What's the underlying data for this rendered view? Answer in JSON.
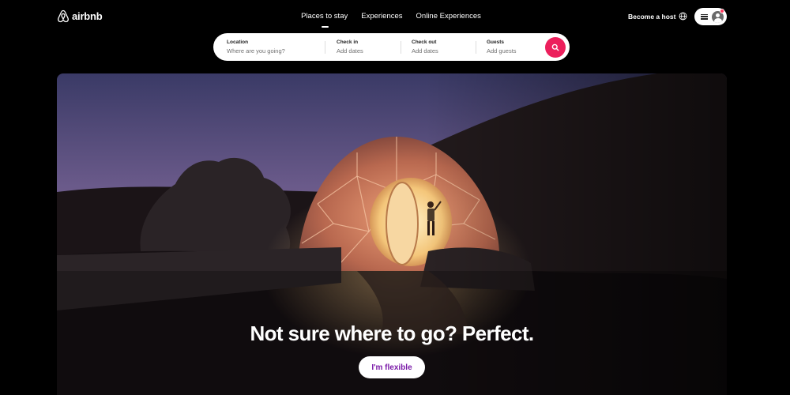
{
  "brand": {
    "name": "airbnb",
    "color": "#ff385c"
  },
  "nav": {
    "items": [
      {
        "label": "Places to stay",
        "active": true
      },
      {
        "label": "Experiences",
        "active": false
      },
      {
        "label": "Online Experiences",
        "active": false
      }
    ]
  },
  "header_right": {
    "become_host": "Become a host",
    "globe_icon": "globe-icon",
    "menu_icon": "hamburger-icon",
    "avatar_icon": "user-avatar-icon",
    "has_notification": true
  },
  "search": {
    "location": {
      "label": "Location",
      "placeholder": "Where are you going?"
    },
    "check_in": {
      "label": "Check in",
      "placeholder": "Add dates"
    },
    "check_out": {
      "label": "Check out",
      "placeholder": "Add dates"
    },
    "guests": {
      "label": "Guests",
      "placeholder": "Add guests"
    },
    "button_icon": "search-icon",
    "button_color": "#ec1f5c"
  },
  "hero": {
    "headline": "Not sure where to go? Perfect.",
    "cta_label": "I'm flexible",
    "cta_color": "#7a1aa8"
  }
}
